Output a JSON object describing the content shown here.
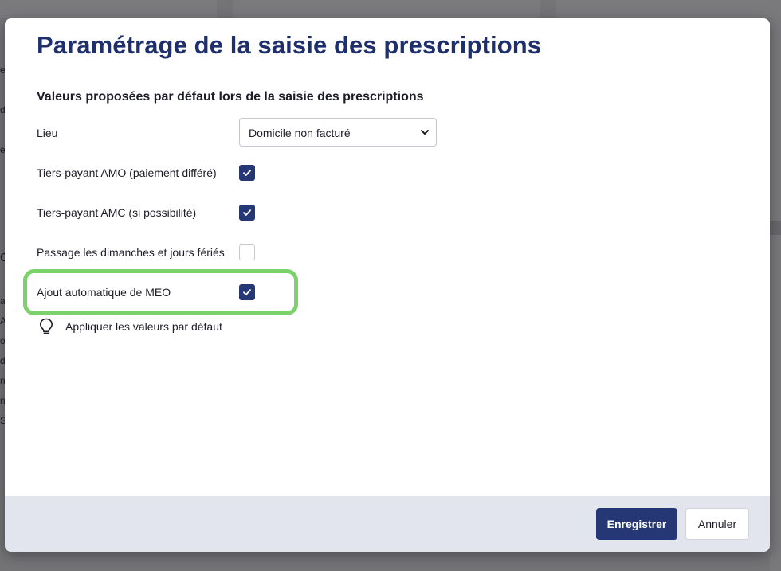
{
  "background": {
    "left_edge_glyphs": [
      "e",
      "d",
      "e",
      "c",
      "a",
      "A",
      "o",
      "d",
      "nt",
      "n",
      "S"
    ]
  },
  "modal": {
    "title": "Paramétrage de la saisie des prescriptions",
    "section_title": "Valeurs proposées par défaut lors de la saisie des prescriptions",
    "lieu": {
      "label": "Lieu",
      "selected": "Domicile non facturé"
    },
    "options": [
      {
        "label": "Tiers-payant AMO (paiement différé)",
        "checked": true
      },
      {
        "label": "Tiers-payant AMC (si possibilité)",
        "checked": true
      },
      {
        "label": "Passage les dimanches et jours fériés",
        "checked": false
      },
      {
        "label": "Ajout automatique de MEO",
        "checked": true,
        "highlighted": true
      }
    ],
    "apply_defaults_label": "Appliquer les valeurs par défaut",
    "icons": {
      "apply_defaults": "lightbulb-icon",
      "select": "chevron-down-icon",
      "checkbox": "check-icon"
    },
    "footer": {
      "save_label": "Enregistrer",
      "cancel_label": "Annuler"
    }
  },
  "colors": {
    "title": "#1e2f6b",
    "primary": "#253775",
    "highlight": "#7bd26a",
    "footer_bg": "#e3e5ee"
  }
}
